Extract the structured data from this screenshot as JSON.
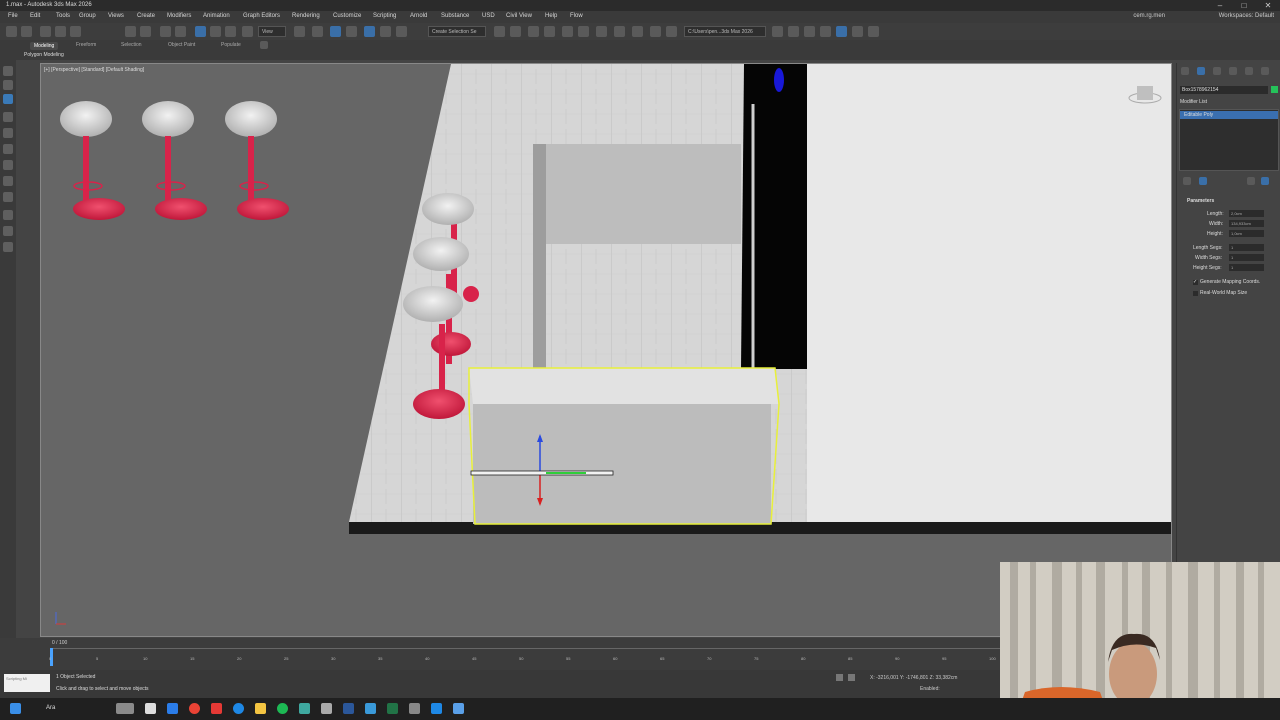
{
  "window": {
    "title": "1.max - Autodesk 3ds Max 2026",
    "min": "–",
    "max": "□",
    "close": "✕"
  },
  "menu": [
    "File",
    "Edit",
    "Tools",
    "Group",
    "Views",
    "Create",
    "Modifiers",
    "Animation",
    "Graph Editors",
    "Rendering",
    "Customize",
    "Scripting",
    "Arnold",
    "Substance",
    "USD",
    "Civil View",
    "Help",
    "Flow"
  ],
  "user": "cem.rg.men",
  "workspace_label": "Workspaces: Default",
  "toolbar": {
    "view_dropdown": "View",
    "selection_set": "Create Selection Se",
    "path_dropdown": "C:\\Users\\pen...3ds Max 2026"
  },
  "ribbon": {
    "tabs": [
      "Modeling",
      "Freeform",
      "Selection",
      "Object Paint",
      "Populate"
    ],
    "active_tab": "Modeling",
    "sub_label": "Polygon Modeling"
  },
  "viewport": {
    "label": "[+] [Perspective] [Standard] [Default Shading]"
  },
  "command_panel": {
    "object_name": "Box1578962154",
    "modifier_list": "Modifier List",
    "stack_item": "Editable Poly",
    "rollout_title": "Parameters",
    "params": [
      {
        "label": "Length:",
        "value": "2,0cm"
      },
      {
        "label": "Width:",
        "value": "134,933cm"
      },
      {
        "label": "Height:",
        "value": "1,0cm"
      },
      {
        "label": "Length Segs:",
        "value": "1"
      },
      {
        "label": "Width Segs:",
        "value": "1"
      },
      {
        "label": "Height Segs:",
        "value": "1"
      }
    ],
    "checkbox_mapping": "Generate Mapping Coords.",
    "checkbox_realworld": "Real-World Map Size"
  },
  "timeline": {
    "slider_text": "0 / 100",
    "ticks": [
      "0",
      "5",
      "10",
      "15",
      "20",
      "25",
      "30",
      "35",
      "40",
      "45",
      "50",
      "55",
      "60",
      "65",
      "70",
      "75",
      "80",
      "85",
      "90",
      "95",
      "100"
    ]
  },
  "status": {
    "selection": "1 Object Selected",
    "prompt": "Click and drag to select and move objects",
    "coords": "X: -3216,001 Y: -1746,801 Z: 33,382cm",
    "enabled": "Enabled:",
    "script_label": "Scripting Mi"
  },
  "taskbar": {
    "search": "Ara"
  },
  "colors": {
    "accent_blue": "#3a7ab8",
    "selection_yellow": "#e8f03a",
    "chair_red": "#d8234a",
    "viewport_bg": "#666666"
  }
}
